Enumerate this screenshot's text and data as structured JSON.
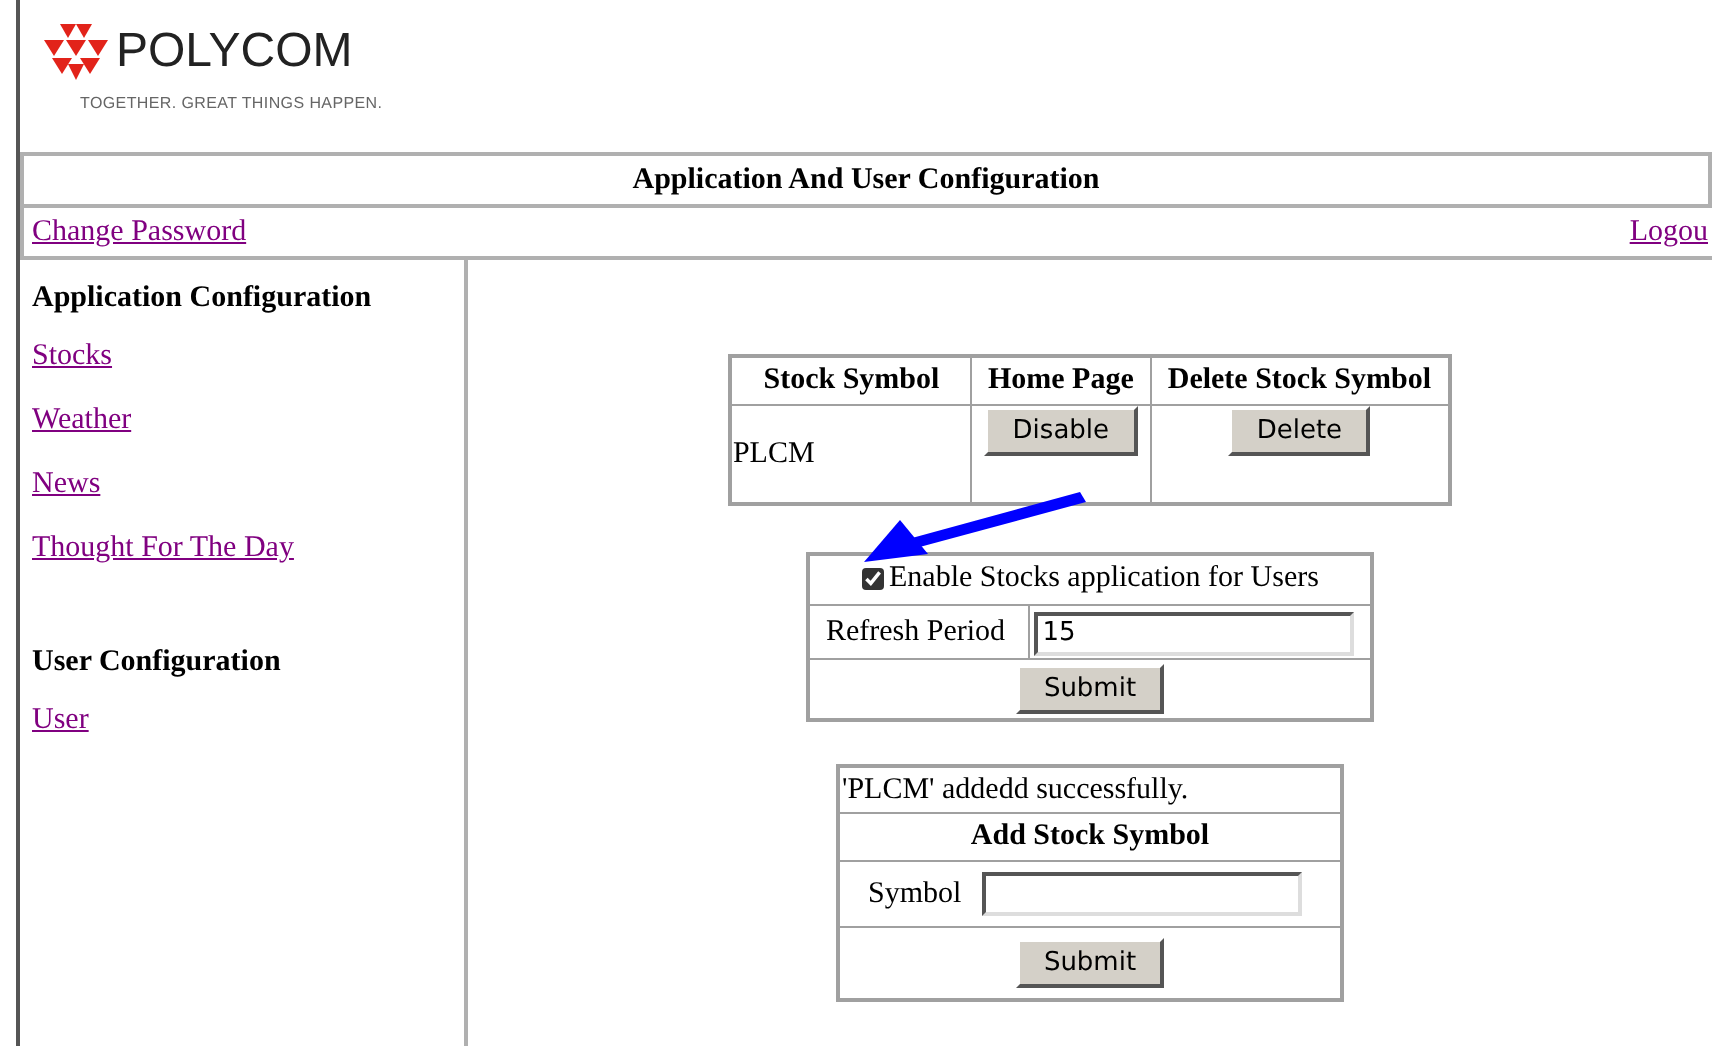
{
  "logo": {
    "name": "POLYCOM",
    "tagline": "TOGETHER. GREAT THINGS HAPPEN."
  },
  "title": "Application And User Configuration",
  "top_links": [
    {
      "label": "Change Password"
    },
    {
      "label": "Logou"
    }
  ],
  "sidebar": {
    "sections": [
      {
        "heading": "Application Configuration",
        "items": [
          {
            "label": "Stocks"
          },
          {
            "label": "Weather"
          },
          {
            "label": "News"
          },
          {
            "label": "Thought For The Day"
          }
        ]
      },
      {
        "heading": "User Configuration",
        "items": [
          {
            "label": "User"
          }
        ]
      }
    ]
  },
  "stocks_table": {
    "columns": [
      "Stock Symbol",
      "Home Page",
      "Delete Stock Symbol"
    ],
    "rows": [
      {
        "symbol": "PLCM",
        "home_button": "Disable",
        "delete_button": "Delete"
      }
    ]
  },
  "settings": {
    "enable": {
      "label": "Enable Stocks application for Users",
      "checked": true
    },
    "refresh": {
      "label": "Refresh Period",
      "value": "15"
    },
    "submit": "Submit"
  },
  "add_form": {
    "message": "'PLCM' addedd successfully.",
    "title": "Add Stock Symbol",
    "symbol_label": "Symbol",
    "submit": "Submit"
  }
}
